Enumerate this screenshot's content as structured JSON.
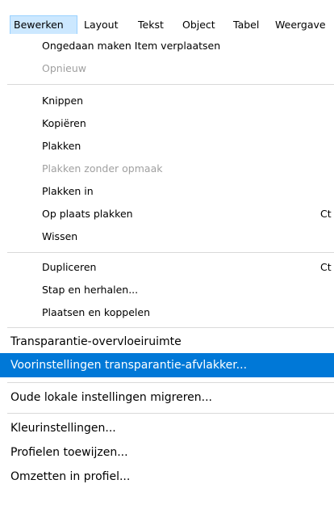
{
  "menubar": {
    "items": [
      {
        "label": "Bewerken"
      },
      {
        "label": "Layout"
      },
      {
        "label": "Tekst"
      },
      {
        "label": "Object"
      },
      {
        "label": "Tabel"
      },
      {
        "label": "Weergave"
      }
    ]
  },
  "menu": {
    "items": [
      {
        "label": "Ongedaan maken Item verplaatsen",
        "shortcut": "",
        "enabled": true
      },
      {
        "label": "Opnieuw",
        "shortcut": "",
        "enabled": false
      },
      {
        "label": "Knippen",
        "shortcut": "",
        "enabled": true
      },
      {
        "label": "Kopiëren",
        "shortcut": "",
        "enabled": true
      },
      {
        "label": "Plakken",
        "shortcut": "",
        "enabled": true
      },
      {
        "label": "Plakken zonder opmaak",
        "shortcut": "",
        "enabled": false
      },
      {
        "label": "Plakken in",
        "shortcut": "",
        "enabled": true
      },
      {
        "label": "Op plaats plakken",
        "shortcut": "Ct",
        "enabled": true
      },
      {
        "label": "Wissen",
        "shortcut": "",
        "enabled": true
      },
      {
        "label": "Dupliceren",
        "shortcut": "Ct",
        "enabled": true
      },
      {
        "label": "Stap en herhalen...",
        "shortcut": "",
        "enabled": true
      },
      {
        "label": "Plaatsen en koppelen",
        "shortcut": "",
        "enabled": true
      },
      {
        "label": "Transparantie-overvloeiruimte",
        "shortcut": "",
        "enabled": true
      },
      {
        "label": "Voorinstellingen transparantie-afvlakker...",
        "shortcut": "",
        "enabled": true,
        "highlighted": true
      },
      {
        "label": "Oude lokale instellingen migreren...",
        "shortcut": "",
        "enabled": true
      },
      {
        "label": "Kleurinstellingen...",
        "shortcut": "",
        "enabled": true
      },
      {
        "label": "Profielen toewijzen...",
        "shortcut": "",
        "enabled": true
      },
      {
        "label": "Omzetten in profiel...",
        "shortcut": "",
        "enabled": true
      }
    ]
  },
  "colors": {
    "highlight": "#0078d7",
    "active_menu_bg": "#cce8ff",
    "disabled_text": "#a0a0a0",
    "separator": "#d9d9d9"
  }
}
